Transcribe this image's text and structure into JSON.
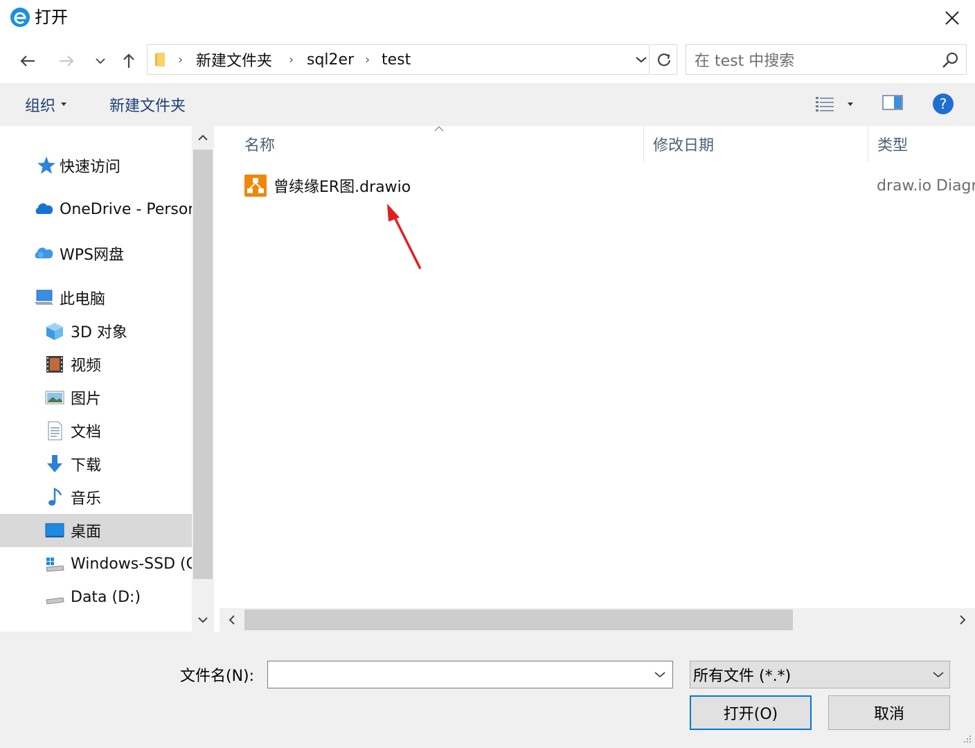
{
  "window": {
    "title": "打开"
  },
  "breadcrumb": [
    "新建文件夹",
    "sql2er",
    "test"
  ],
  "search": {
    "placeholder": "在 test 中搜索"
  },
  "toolbar": {
    "organize": "组织",
    "new_folder": "新建文件夹"
  },
  "sidebar": {
    "items": [
      {
        "label": "快速访问",
        "icon": "quick-access-star-icon"
      },
      {
        "label": "OneDrive - Personal",
        "icon": "onedrive-cloud-icon"
      },
      {
        "label": "WPS网盘",
        "icon": "wps-cloud-icon"
      },
      {
        "label": "此电脑",
        "icon": "computer-icon"
      },
      {
        "label": "3D 对象",
        "icon": "3d-objects-icon"
      },
      {
        "label": "视频",
        "icon": "videos-icon"
      },
      {
        "label": "图片",
        "icon": "pictures-icon"
      },
      {
        "label": "文档",
        "icon": "documents-icon"
      },
      {
        "label": "下载",
        "icon": "downloads-icon"
      },
      {
        "label": "音乐",
        "icon": "music-icon"
      },
      {
        "label": "桌面",
        "icon": "desktop-icon",
        "selected": true
      },
      {
        "label": "Windows-SSD (C:)",
        "icon": "drive-c-icon"
      },
      {
        "label": "Data (D:)",
        "icon": "drive-d-icon"
      }
    ]
  },
  "columns": {
    "name": "名称",
    "modified": "修改日期",
    "type": "类型"
  },
  "files": [
    {
      "name": "曾续缘ER图.drawio",
      "type": "draw.io Diagram",
      "icon": "drawio-file-icon"
    }
  ],
  "bottom": {
    "filename_label": "文件名(N):",
    "filename_value": "",
    "filter": "所有文件 (*.*)",
    "open": "打开(O)",
    "cancel": "取消"
  },
  "colors": {
    "accent": "#0078d7",
    "annotation_arrow": "#e02020",
    "drawio_orange": "#f08705"
  }
}
